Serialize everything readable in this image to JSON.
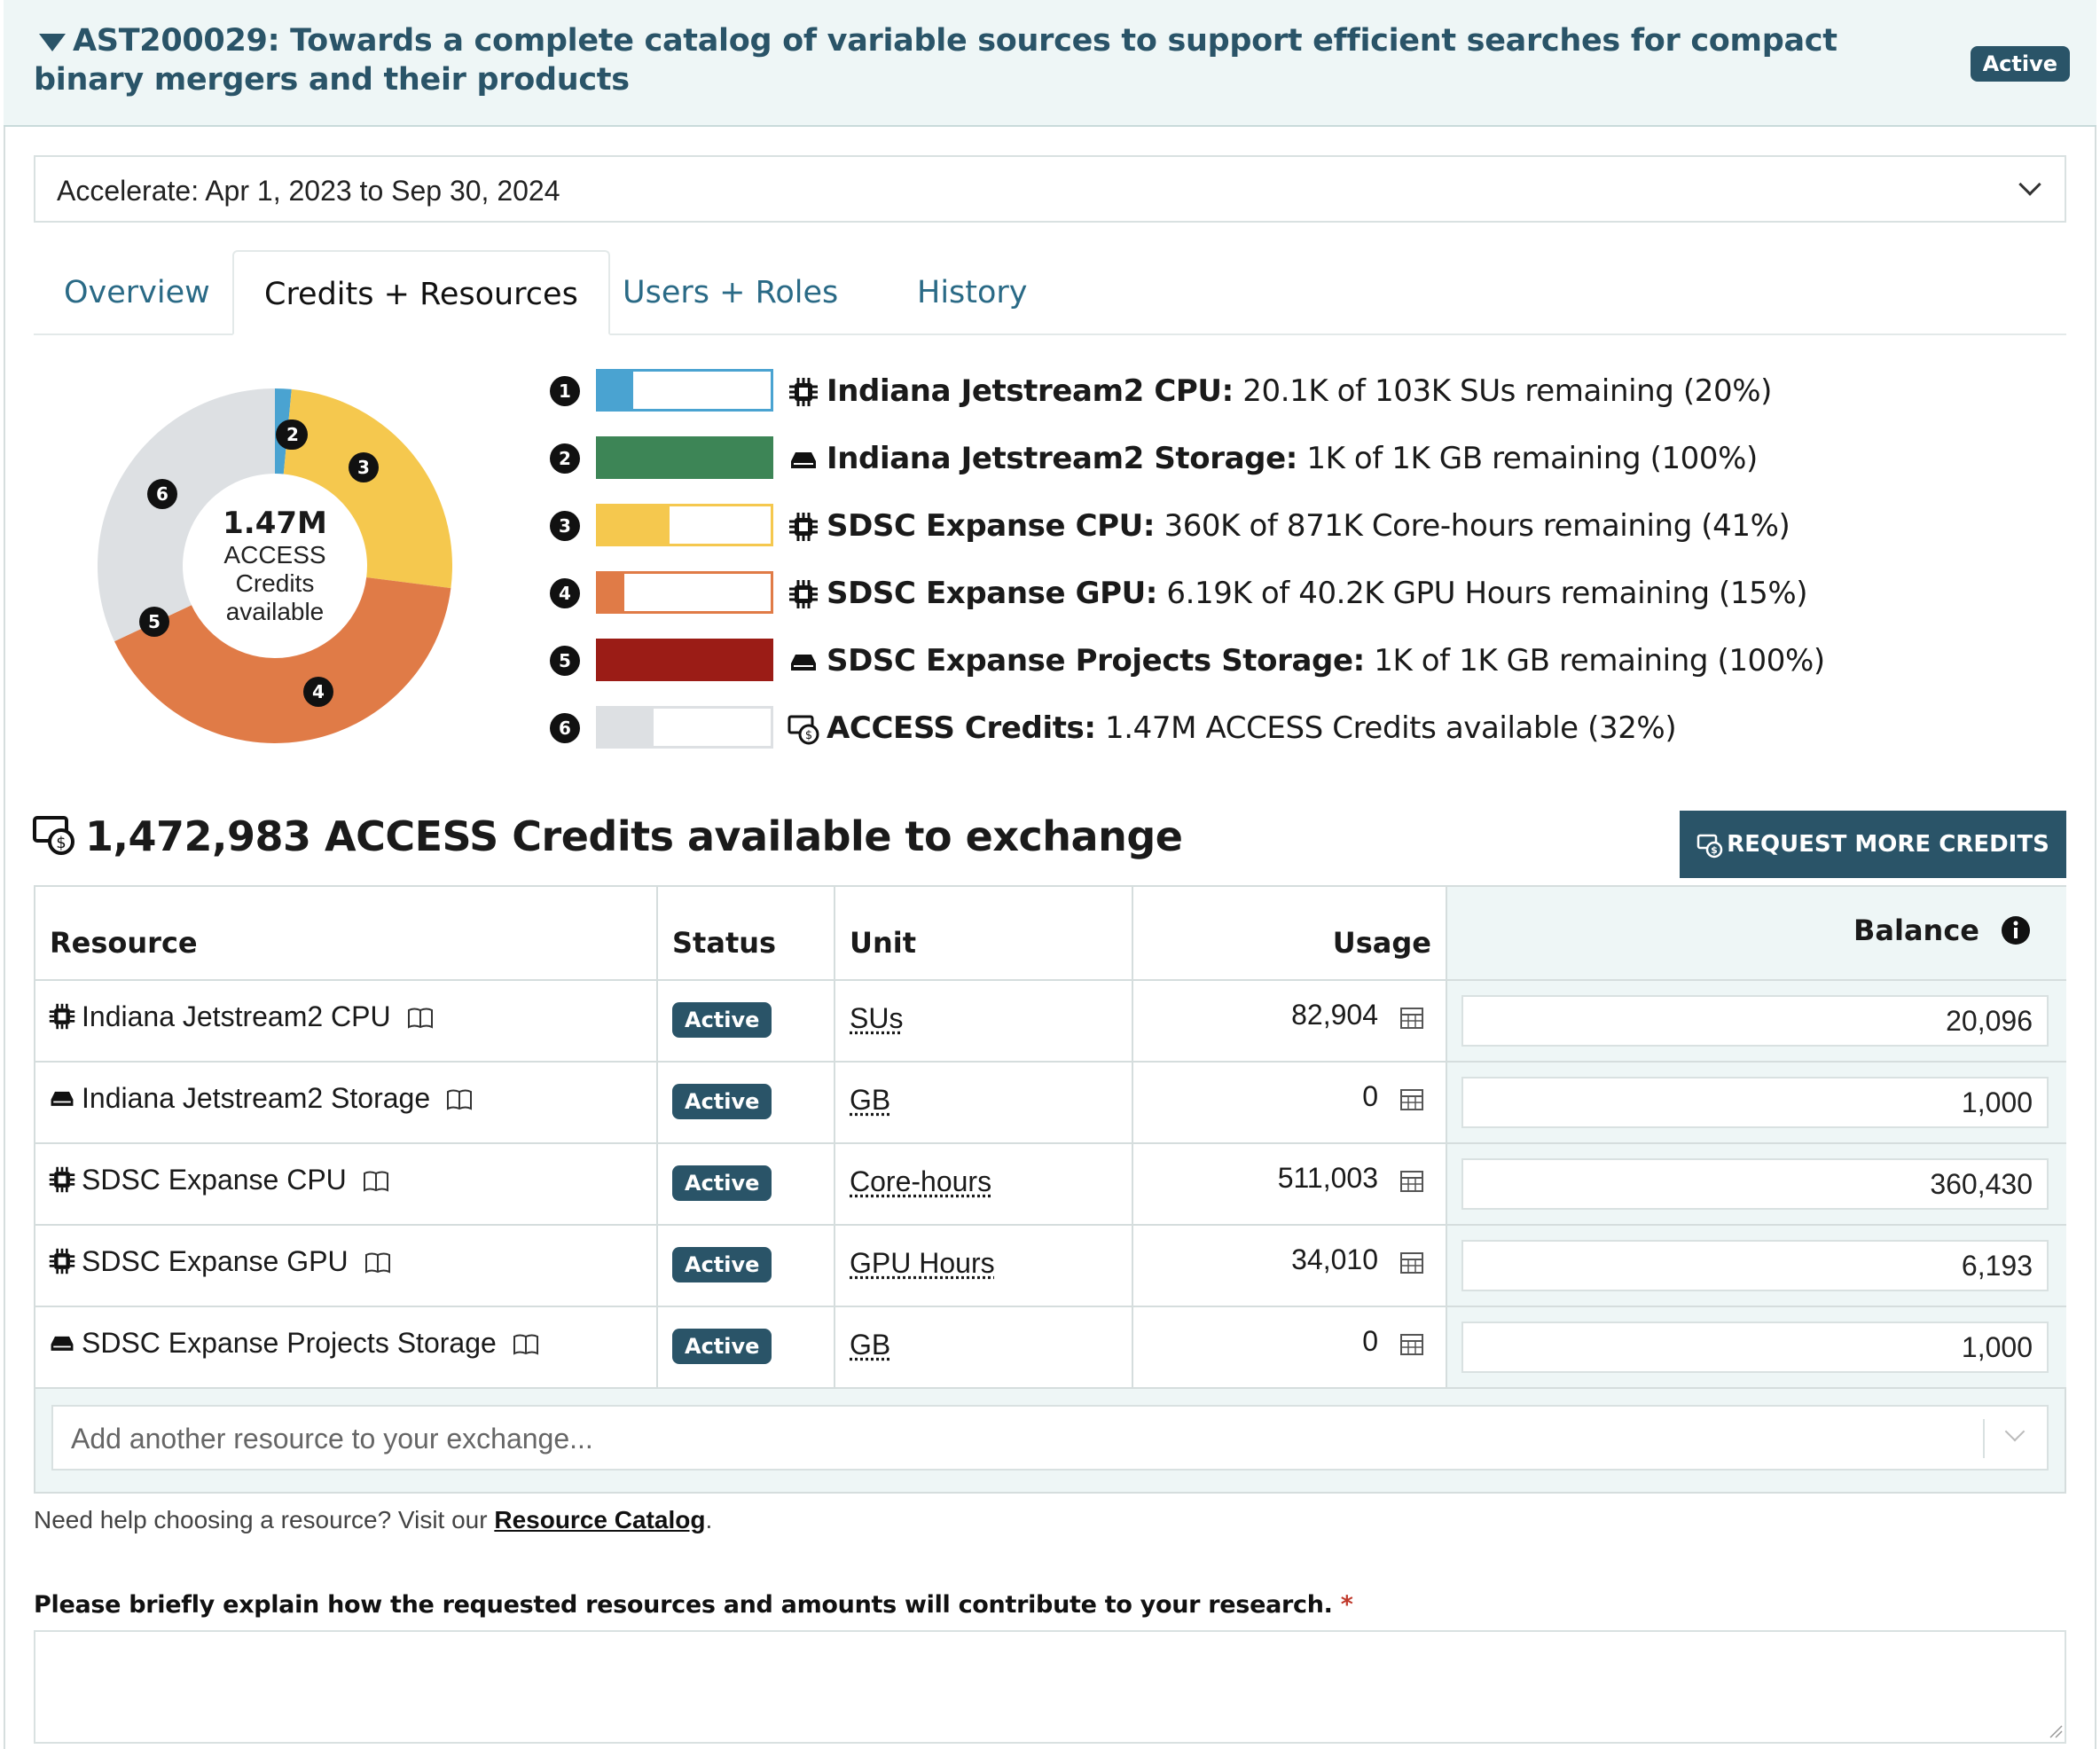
{
  "project": {
    "title": "AST200029: Towards a complete catalog of variable sources to support efficient searches for compact binary mergers and their products",
    "status": "Active"
  },
  "allocation_select": {
    "value": "Accelerate: Apr 1, 2023 to Sep 30, 2024"
  },
  "tabs": [
    {
      "label": "Overview",
      "active": false
    },
    {
      "label": "Credits + Resources",
      "active": true
    },
    {
      "label": "Users + Roles",
      "active": false
    },
    {
      "label": "History",
      "active": false
    }
  ],
  "donut": {
    "center_value": "1.47M",
    "center_line1": "ACCESS",
    "center_line2": "Credits",
    "center_line3": "available"
  },
  "legend": [
    {
      "num": "1",
      "name": "Indiana Jetstream2 CPU:",
      "detail": "20.1K of 103K SUs remaining (20%)",
      "color": "#4aa3d1",
      "remaining": 0.2,
      "icon": "chip-icon"
    },
    {
      "num": "2",
      "name": "Indiana Jetstream2 Storage:",
      "detail": "1K of 1K GB remaining (100%)",
      "color": "#3d8556",
      "remaining": 1.0,
      "icon": "storage-icon"
    },
    {
      "num": "3",
      "name": "SDSC Expanse CPU:",
      "detail": "360K of 871K Core-hours remaining (41%)",
      "color": "#f5c84e",
      "remaining": 0.41,
      "icon": "chip-icon"
    },
    {
      "num": "4",
      "name": "SDSC Expanse GPU:",
      "detail": "6.19K of 40.2K GPU Hours remaining (15%)",
      "color": "#e07b47",
      "remaining": 0.15,
      "icon": "chip-icon"
    },
    {
      "num": "5",
      "name": "SDSC Expanse Projects Storage:",
      "detail": "1K of 1K GB remaining (100%)",
      "color": "#9b1c16",
      "remaining": 1.0,
      "icon": "storage-icon"
    },
    {
      "num": "6",
      "name": "ACCESS Credits:",
      "detail": "1.47M ACCESS Credits available (32%)",
      "color": "#dde0e3",
      "remaining": 0.32,
      "icon": "credits-icon"
    }
  ],
  "credits": {
    "heading": "1,472,983 ACCESS Credits available to exchange",
    "request_button": "REQUEST MORE CREDITS"
  },
  "table": {
    "headers": {
      "resource": "Resource",
      "status": "Status",
      "unit": "Unit",
      "usage": "Usage",
      "balance": "Balance"
    },
    "rows": [
      {
        "resource": "Indiana Jetstream2 CPU",
        "icon": "chip-icon",
        "status": "Active",
        "unit": "SUs",
        "usage": "82,904",
        "balance": "20,096"
      },
      {
        "resource": "Indiana Jetstream2 Storage",
        "icon": "storage-icon",
        "status": "Active",
        "unit": "GB",
        "usage": "0",
        "balance": "1,000"
      },
      {
        "resource": "SDSC Expanse CPU",
        "icon": "chip-icon",
        "status": "Active",
        "unit": "Core-hours",
        "usage": "511,003",
        "balance": "360,430"
      },
      {
        "resource": "SDSC Expanse GPU",
        "icon": "chip-icon",
        "status": "Active",
        "unit": "GPU Hours",
        "usage": "34,010",
        "balance": "6,193"
      },
      {
        "resource": "SDSC Expanse Projects Storage",
        "icon": "storage-icon",
        "status": "Active",
        "unit": "GB",
        "usage": "0",
        "balance": "1,000"
      }
    ],
    "add_placeholder": "Add another resource to your exchange..."
  },
  "help": {
    "prefix": "Need help choosing a resource? Visit our ",
    "link": "Resource Catalog",
    "suffix": "."
  },
  "question": {
    "label": "Please briefly explain how the requested resources and amounts will contribute to your research.",
    "required_mark": "*",
    "value": ""
  }
}
